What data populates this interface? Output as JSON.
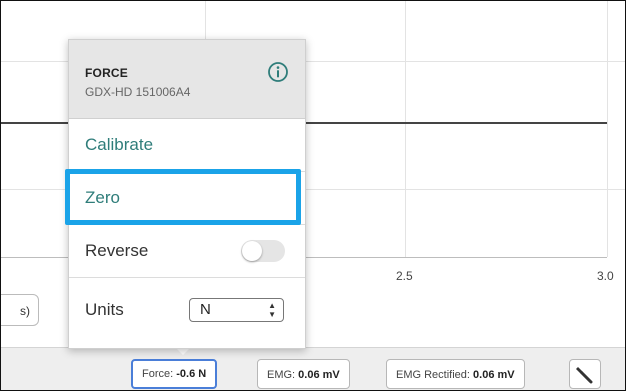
{
  "graph": {
    "tick_labels": [
      "2.5",
      "3.0"
    ],
    "partial_button_label": "s)"
  },
  "popover": {
    "title": "FORCE",
    "subtitle": "GDX-HD 151006A4",
    "info_icon": "info-circle-icon",
    "items": {
      "calibrate": "Calibrate",
      "zero": "Zero",
      "reverse": "Reverse",
      "units": "Units"
    },
    "reverse_toggle_on": false,
    "units_value": "N",
    "highlight_color": "#1aa3e8"
  },
  "bottom_bar": {
    "chips": [
      {
        "label": "Force: ",
        "value": "-0.6 N"
      },
      {
        "label": "EMG: ",
        "value": "0.06 mV"
      },
      {
        "label": "EMG Rectified: ",
        "value": "0.06 mV"
      }
    ],
    "tool_icon": "wrench-icon"
  }
}
